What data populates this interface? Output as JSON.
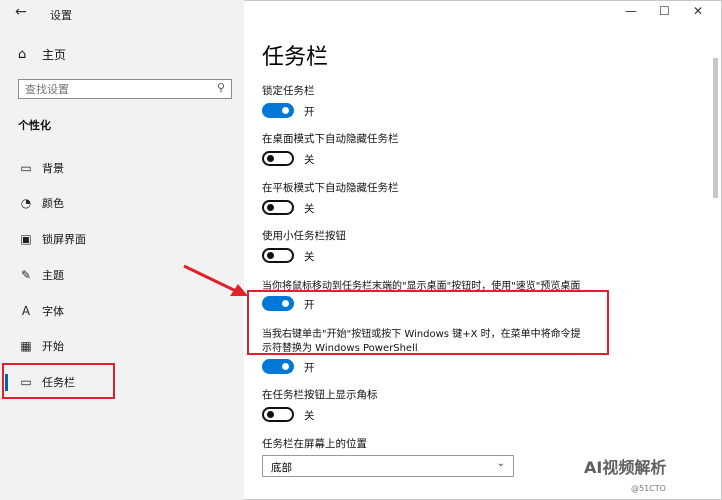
{
  "window": {
    "title": "设置",
    "back_glyph": "←",
    "minimize_glyph": "—",
    "maximize_glyph": "☐",
    "close_glyph": "✕"
  },
  "sidebar": {
    "home_label": "主页",
    "search_placeholder": "查找设置",
    "section_title": "个性化",
    "items": [
      {
        "label": "背景",
        "icon": "picture-icon",
        "glyph": "▭"
      },
      {
        "label": "颜色",
        "icon": "palette-icon",
        "glyph": "◔"
      },
      {
        "label": "锁屏界面",
        "icon": "lockscreen-icon",
        "glyph": "▣"
      },
      {
        "label": "主题",
        "icon": "theme-icon",
        "glyph": "✎"
      },
      {
        "label": "字体",
        "icon": "font-icon",
        "glyph": "A"
      },
      {
        "label": "开始",
        "icon": "start-icon",
        "glyph": "▦"
      },
      {
        "label": "任务栏",
        "icon": "taskbar-icon",
        "glyph": "▭",
        "active": true
      }
    ]
  },
  "main": {
    "title": "任务栏",
    "settings": [
      {
        "label": "锁定任务栏",
        "state": "开",
        "on": true
      },
      {
        "label": "在桌面模式下自动隐藏任务栏",
        "state": "关",
        "on": false
      },
      {
        "label": "在平板模式下自动隐藏任务栏",
        "state": "关",
        "on": false
      },
      {
        "label": "使用小任务栏按钮",
        "state": "关",
        "on": false
      },
      {
        "label": "当你将鼠标移动到任务栏末端的\"显示桌面\"按钮时，使用\"速览\"预览桌面",
        "state": "开",
        "on": true
      },
      {
        "label_line1": "当我右键单击\"开始\"按钮或按下 Windows 键+X 时，在菜单中将命令提",
        "label_line2": "示符替换为 Windows PowerShell",
        "state": "开",
        "on": true
      },
      {
        "label": "在任务栏按钮上显示角标",
        "state": "关",
        "on": false
      }
    ],
    "position_label": "任务栏在屏幕上的位置",
    "position_value": "底部"
  },
  "watermark": {
    "text": "AI视频解析",
    "subtext": "@51CTO"
  },
  "colors": {
    "accent": "#0078d7",
    "highlight": "#e0202a",
    "sidebar_bg": "#f2f2f2"
  }
}
